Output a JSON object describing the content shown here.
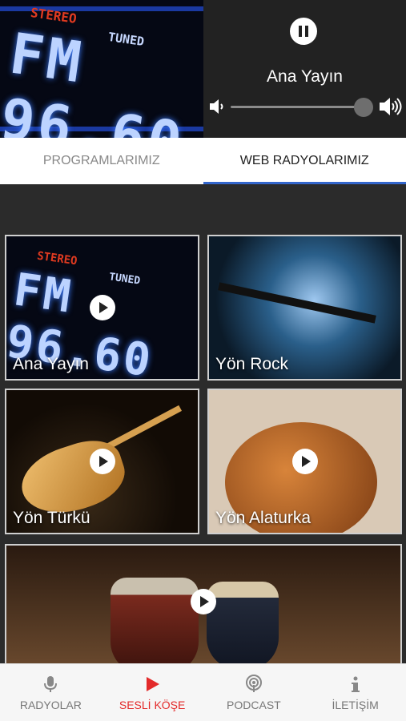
{
  "player": {
    "artwork_text": {
      "stereo": "STEREO",
      "tuned": "TUNED",
      "frequency": "FM 96.60"
    },
    "station_title": "Ana Yayın",
    "volume_level": 0.9
  },
  "tabs": [
    {
      "label": "PROGRAMLARIMIZ",
      "active": false
    },
    {
      "label": "WEB RADYOLARIMIZ",
      "active": true
    }
  ],
  "stations": [
    {
      "label": "Ana Yayın",
      "artwork_text": {
        "stereo": "STEREO",
        "tuned": "TUNED",
        "frequency": "FM 96.60"
      }
    },
    {
      "label": "Yön Rock"
    },
    {
      "label": "Yön Türkü"
    },
    {
      "label": "Yön Alaturka"
    },
    {
      "label": ""
    }
  ],
  "bottom_nav": [
    {
      "label": "RADYOLAR",
      "icon": "microphone-icon",
      "active": false
    },
    {
      "label": "SESLİ KÖŞE",
      "icon": "play-icon",
      "active": true
    },
    {
      "label": "PODCAST",
      "icon": "podcast-icon",
      "active": false
    },
    {
      "label": "İLETİŞİM",
      "icon": "info-icon",
      "active": false
    }
  ],
  "colors": {
    "accent": "#3366cc",
    "active_nav": "#e32a2a"
  }
}
